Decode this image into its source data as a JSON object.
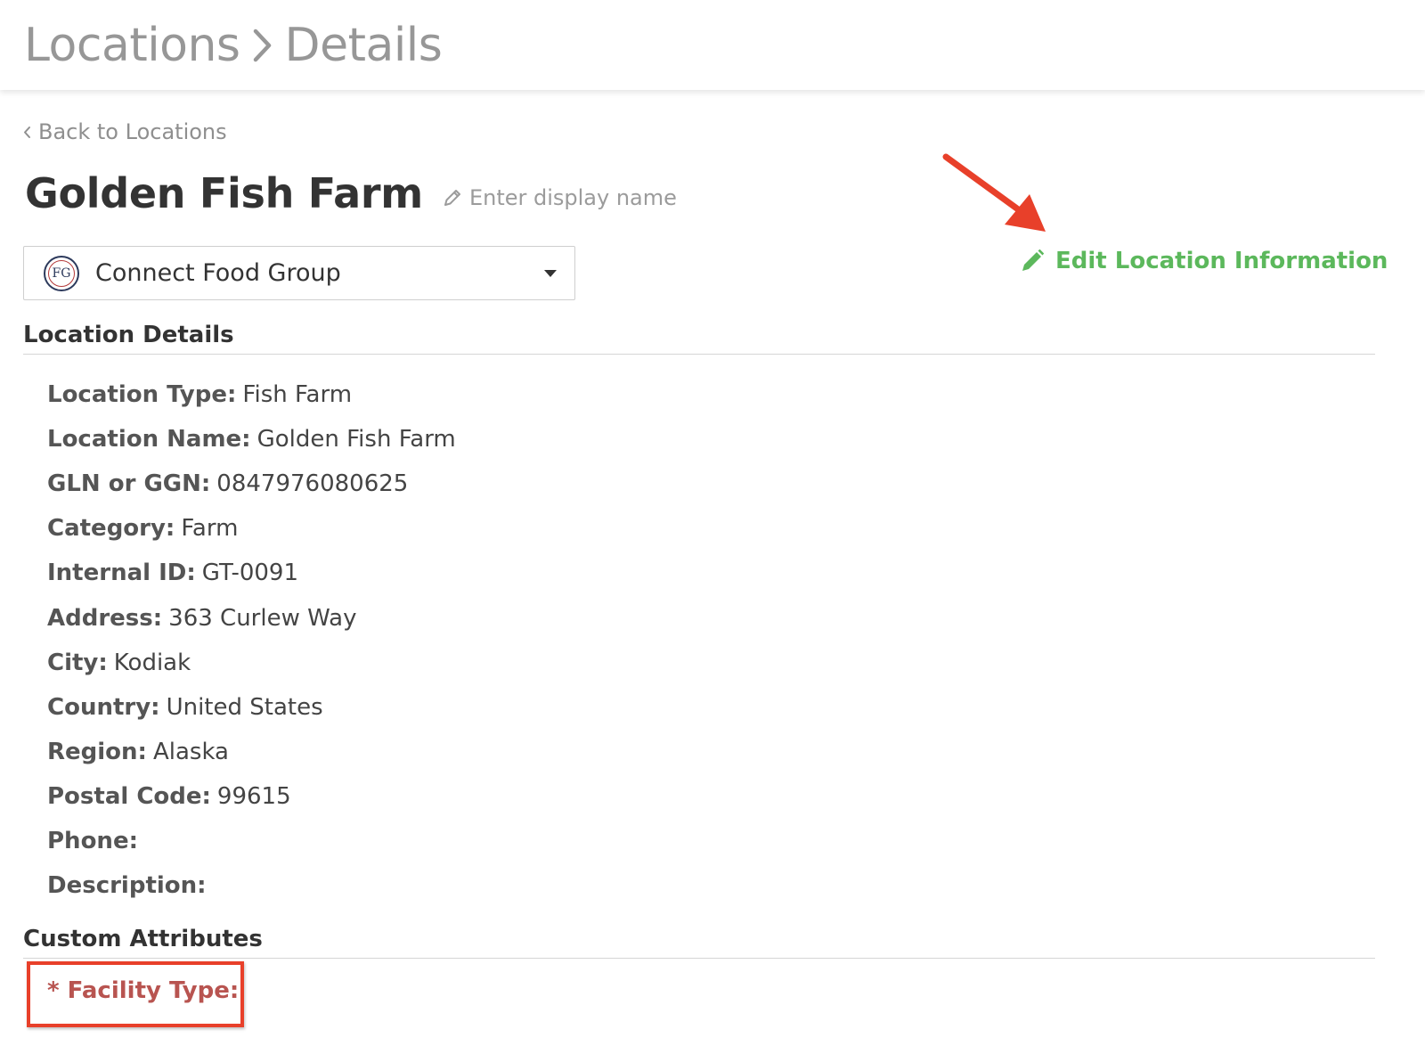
{
  "header": {
    "crumb_root": "Locations",
    "crumb_current": "Details"
  },
  "back_link": "Back to Locations",
  "location_title": "Golden Fish Farm",
  "display_name_placeholder": "Enter display name",
  "org_select": {
    "logo_text": "FG",
    "selected": "Connect Food Group"
  },
  "edit_link": "Edit Location Information",
  "sections": {
    "details_title": "Location Details",
    "custom_title": "Custom Attributes"
  },
  "details": [
    {
      "label": "Location Type:",
      "value": "Fish Farm"
    },
    {
      "label": "Location Name:",
      "value": "Golden Fish Farm"
    },
    {
      "label": "GLN or GGN:",
      "value": "0847976080625"
    },
    {
      "label": "Category:",
      "value": "Farm"
    },
    {
      "label": "Internal ID:",
      "value": "GT-0091"
    },
    {
      "label": "Address:",
      "value": "363 Curlew Way"
    },
    {
      "label": "City:",
      "value": "Kodiak"
    },
    {
      "label": "Country:",
      "value": "United States"
    },
    {
      "label": "Region:",
      "value": "Alaska"
    },
    {
      "label": "Postal Code:",
      "value": "99615"
    },
    {
      "label": "Phone:",
      "value": ""
    },
    {
      "label": "Description:",
      "value": ""
    }
  ],
  "custom_attributes": {
    "facility_type_label": "* Facility Type:"
  },
  "colors": {
    "accent_green": "#5cb85c",
    "annotation_red": "#e8402a",
    "required_label": "#b85450"
  },
  "icons": [
    "chevron-right-icon",
    "chevron-left-icon",
    "pencil-icon",
    "dropdown-caret-icon",
    "annotation-arrow-icon"
  ]
}
